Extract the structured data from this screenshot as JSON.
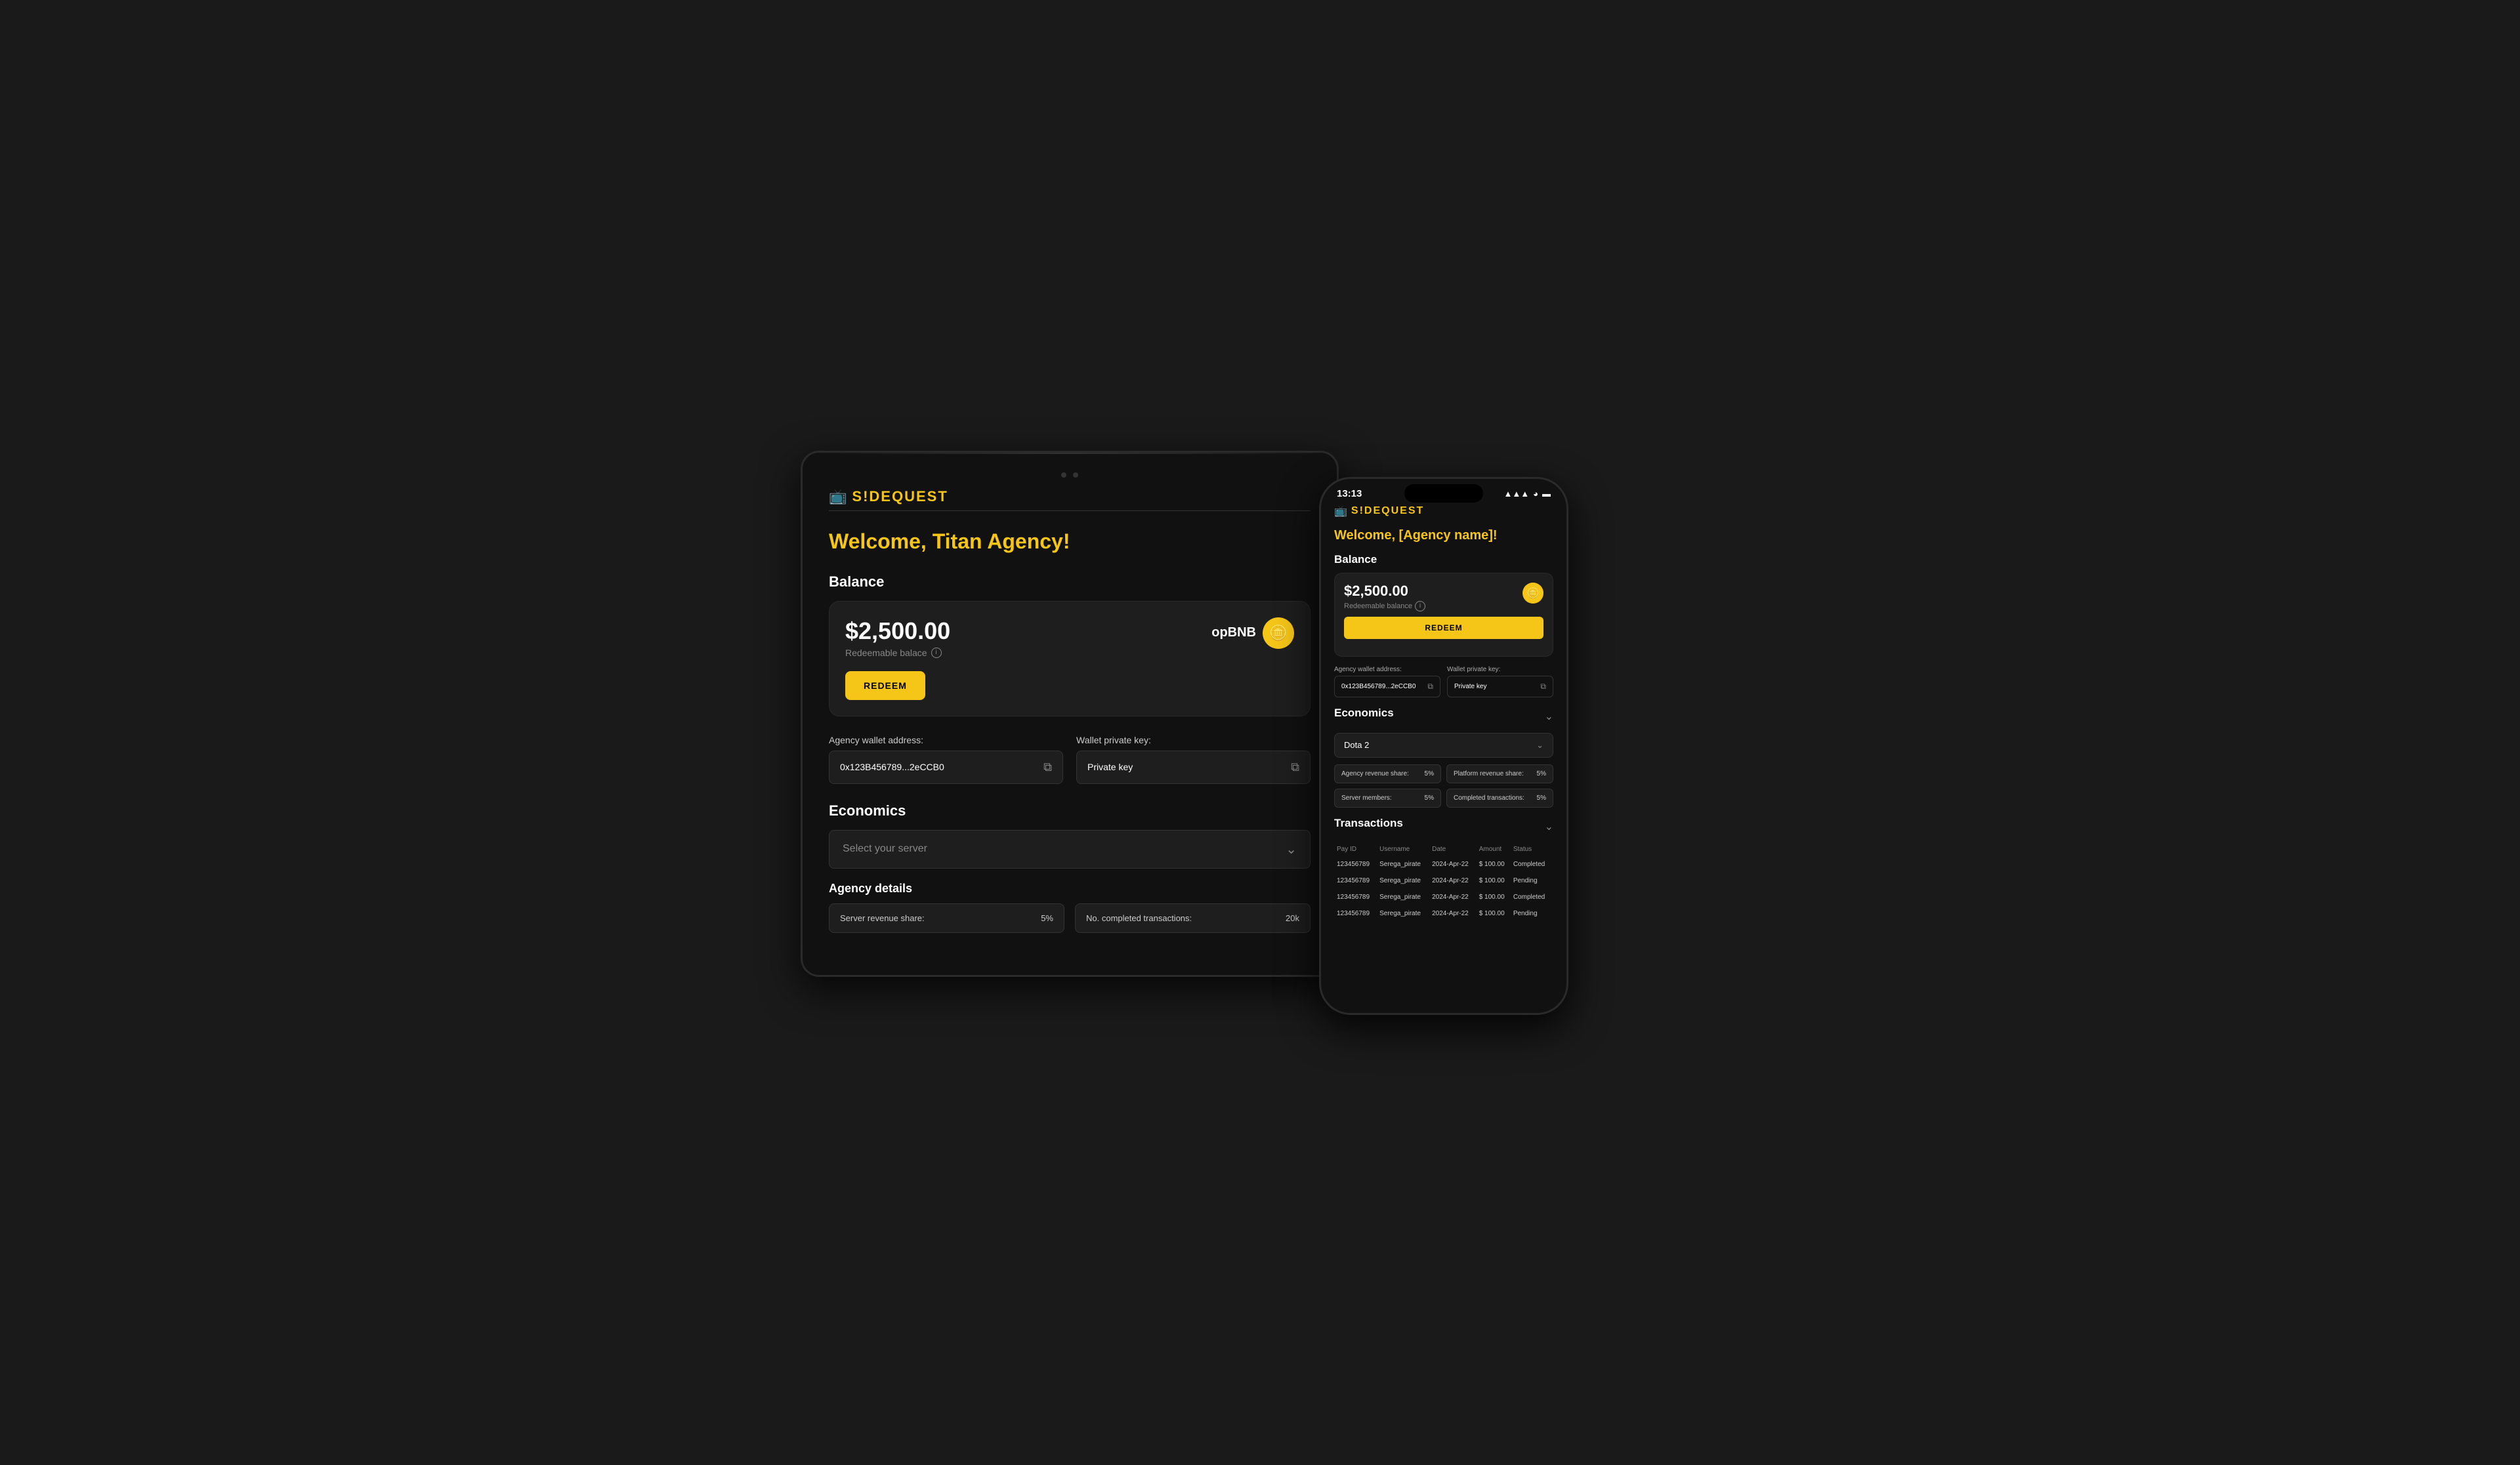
{
  "tablet": {
    "welcome": "Welcome, Titan Agency!",
    "balance_section": "Balance",
    "balance_amount": "$2,500.00",
    "balance_label": "Redeemable balace",
    "opbnb_label": "opBNB",
    "redeem_btn": "REDEEM",
    "wallet_address_label": "Agency wallet address:",
    "wallet_address_value": "0x123B456789...2eCCB0",
    "wallet_private_label": "Wallet private key:",
    "wallet_private_value": "Private key",
    "economics_section": "Economics",
    "server_placeholder": "Select your server",
    "agency_details_title": "Agency details",
    "server_revenue_label": "Server revenue share:",
    "server_revenue_value": "5%",
    "completed_tx_label": "No. completed transactions:",
    "completed_tx_value": "20k"
  },
  "phone": {
    "time": "13:13",
    "signal": "▲▲▲",
    "wifi": "WiFi",
    "battery": "🔋",
    "welcome": "Welcome, [Agency name]!",
    "balance_section": "Balance",
    "balance_amount": "$2,500.00",
    "balance_label": "Redeemable balance",
    "redeem_btn": "REDEEM",
    "wallet_address_label": "Agency wallet address:",
    "wallet_address_value": "0x123B456789...2eCCB0",
    "wallet_private_label": "Wallet private key:",
    "wallet_private_value": "Private key",
    "economics_section": "Economics",
    "economics_chevron": "⊙",
    "dota2_label": "Dota 2",
    "agency_revenue_label": "Agency revenue share:",
    "agency_revenue_value": "5%",
    "platform_revenue_label": "Platform revenue share:",
    "platform_revenue_value": "5%",
    "server_members_label": "Server members:",
    "server_members_value": "5%",
    "completed_tx_label": "Completed transactions:",
    "completed_tx_value": "5%",
    "transactions_section": "Transactions",
    "transactions_chevron": "⊙",
    "tx_col_payid": "Pay ID",
    "tx_col_username": "Username",
    "tx_col_date": "Date",
    "tx_col_amount": "Amount",
    "tx_col_status": "Status",
    "transactions": [
      {
        "pay_id": "123456789",
        "username": "Serega_pirate",
        "date": "2024-Apr-22",
        "amount": "$ 100.00",
        "status": "Completed"
      },
      {
        "pay_id": "123456789",
        "username": "Serega_pirate",
        "date": "2024-Apr-22",
        "amount": "$ 100.00",
        "status": "Pending"
      },
      {
        "pay_id": "123456789",
        "username": "Serega_pirate",
        "date": "2024-Apr-22",
        "amount": "$ 100.00",
        "status": "Completed"
      },
      {
        "pay_id": "123456789",
        "username": "Serega_pirate",
        "date": "2024-Apr-22",
        "amount": "$ 100.00",
        "status": "Pending"
      }
    ]
  },
  "logo": {
    "icon": "📺",
    "text": "S!DEQUEST"
  }
}
